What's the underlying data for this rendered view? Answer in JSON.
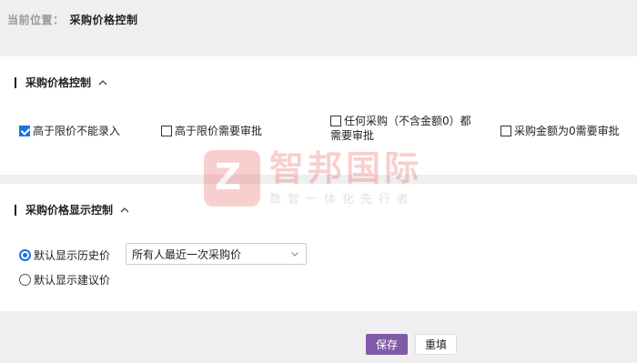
{
  "breadcrumb": {
    "label": "当前位置：",
    "current": "采购价格控制"
  },
  "section1": {
    "title": "采购价格控制",
    "options": [
      {
        "label": "高于限价不能录入",
        "checked": true
      },
      {
        "label": "高于限价需要审批",
        "checked": false
      },
      {
        "label_line1": "任何采购（不含金额0）都",
        "label_line2": "需要审批",
        "checked": false
      },
      {
        "label": "采购金额为0需要审批",
        "checked": false
      }
    ]
  },
  "section2": {
    "title": "采购价格显示控制",
    "radio_history": {
      "label": "默认显示历史价",
      "checked": true
    },
    "history_select": {
      "value": "所有人最近一次采购价"
    },
    "radio_suggest": {
      "label": "默认显示建议价",
      "checked": false
    }
  },
  "watermark": {
    "title": "智邦国际",
    "subtitle": "数智一体化先行者",
    "logo_letter": "Z"
  },
  "actions": {
    "save_label": "保存",
    "reset_label": "重填"
  },
  "colors": {
    "accent": "#1a73e8",
    "save_button": "#7f5ba8",
    "watermark_red": "#e02a2a"
  }
}
